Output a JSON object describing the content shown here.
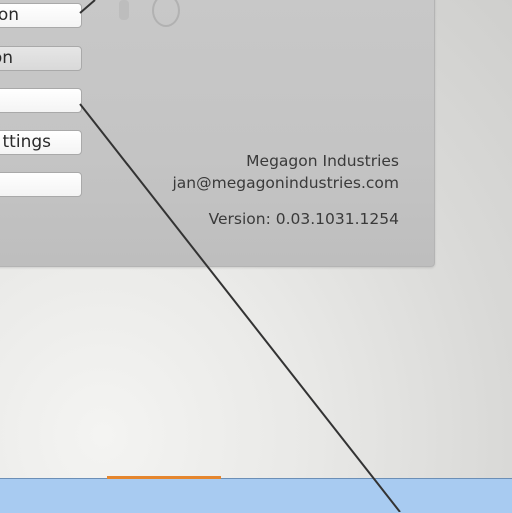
{
  "menu": {
    "items": [
      {
        "label": "on"
      },
      {
        "label": "on"
      },
      {
        "label": ""
      },
      {
        "label": "ttings"
      },
      {
        "label": ""
      }
    ]
  },
  "about": {
    "company": "Megagon Industries",
    "email": "jan@megagonindustries.com",
    "version": "Version: 0.03.1031.1254"
  },
  "colors": {
    "panel": "#c4c4c4",
    "taskbar": "#a8cbf1",
    "tab_accent": "#e5862e"
  }
}
